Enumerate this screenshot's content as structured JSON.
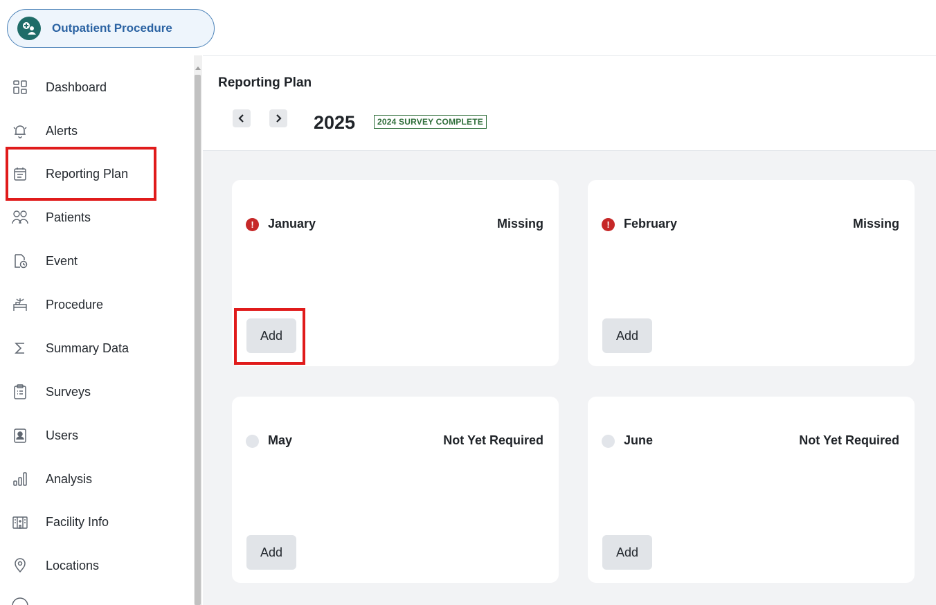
{
  "app": {
    "name": "Outpatient Procedure",
    "logo_icon": "patient-care-icon"
  },
  "sidebar": {
    "items": [
      {
        "label": "Dashboard",
        "icon": "dashboard-icon"
      },
      {
        "label": "Alerts",
        "icon": "bell-icon"
      },
      {
        "label": "Reporting Plan",
        "icon": "calendar-icon",
        "active": true
      },
      {
        "label": "Patients",
        "icon": "patients-icon"
      },
      {
        "label": "Event",
        "icon": "event-icon"
      },
      {
        "label": "Procedure",
        "icon": "procedure-icon"
      },
      {
        "label": "Summary Data",
        "icon": "sigma-icon"
      },
      {
        "label": "Surveys",
        "icon": "clipboard-icon"
      },
      {
        "label": "Users",
        "icon": "user-badge-icon"
      },
      {
        "label": "Analysis",
        "icon": "bar-chart-icon"
      },
      {
        "label": "Facility Info",
        "icon": "building-icon"
      },
      {
        "label": "Locations",
        "icon": "location-pin-icon"
      }
    ]
  },
  "header": {
    "title": "Reporting Plan",
    "year": "2025",
    "badge": "2024 SURVEY COMPLETE"
  },
  "cards": [
    {
      "month": "January",
      "status": "Missing",
      "state": "missing",
      "button": "Add"
    },
    {
      "month": "February",
      "status": "Missing",
      "state": "missing",
      "button": "Add"
    },
    {
      "month": "May",
      "status": "Not Yet Required",
      "state": "pending",
      "button": "Add"
    },
    {
      "month": "June",
      "status": "Not Yet Required",
      "state": "pending",
      "button": "Add"
    }
  ],
  "colors": {
    "brand": "#2b63a3",
    "logo_bg": "#1f6c68",
    "missing": "#c62828",
    "badge": "#2f6e3a",
    "highlight": "#e01b1b"
  }
}
